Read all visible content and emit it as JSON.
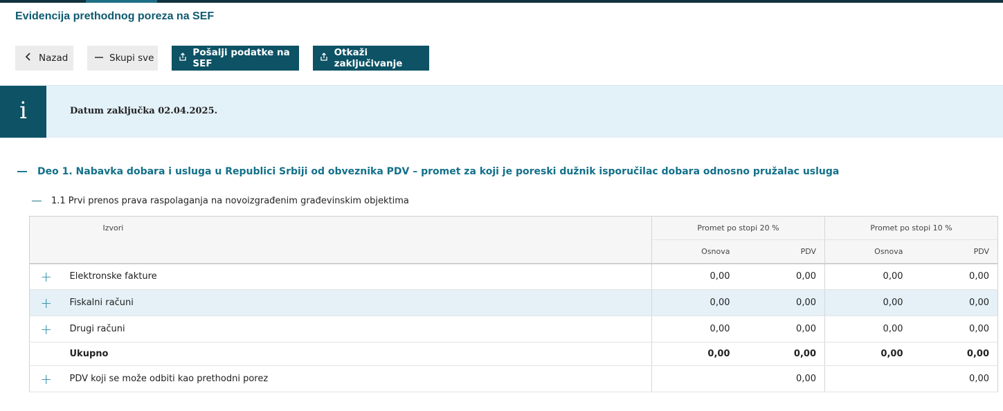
{
  "page": {
    "title": "Evidencija prethodnog poreza na SEF"
  },
  "toolbar": {
    "back_label": "Nazad",
    "collapse_label": "Skupi sve",
    "send_label": "Pošalji podatke na SEF",
    "cancel_label": "Otkaži zaključivanje"
  },
  "info": {
    "text": "Datum zaključka 02.04.2025."
  },
  "section1": {
    "title": "Deo 1. Nabavka dobara i usluga u Republici Srbiji od obveznika PDV – promet za koji je poreski dužnik isporučilac dobara odnosno pružalac usluga",
    "sub": {
      "title": "1.1 Prvi prenos prava raspolaganja na novoizgrađenim građevinskim objektima",
      "table": {
        "headers": {
          "izvori": "Izvori",
          "group20": "Promet po stopi 20 %",
          "group10": "Promet po stopi 10 %",
          "osnova": "Osnova",
          "pdv": "PDV"
        },
        "rows": [
          {
            "label": "Elektronske fakture",
            "o20": "0,00",
            "p20": "0,00",
            "o10": "0,00",
            "p10": "0,00"
          },
          {
            "label": "Fiskalni računi",
            "o20": "0,00",
            "p20": "0,00",
            "o10": "0,00",
            "p10": "0,00"
          },
          {
            "label": "Drugi računi",
            "o20": "0,00",
            "p20": "0,00",
            "o10": "0,00",
            "p10": "0,00"
          }
        ],
        "total": {
          "label": "Ukupno",
          "o20": "0,00",
          "p20": "0,00",
          "o10": "0,00",
          "p10": "0,00"
        },
        "deductible": {
          "label": "PDV koji se može odbiti kao prethodni porez",
          "p20": "0,00",
          "p10": "0,00"
        }
      }
    }
  },
  "colors": {
    "primary": "#0d5265",
    "accent": "#137089",
    "info_bg": "#e3f1f9",
    "highlight_row": "#e5f1f7"
  },
  "icons": {
    "back": "chevron-left-icon",
    "collapse": "minus-icon",
    "send": "share-upload-icon",
    "cancel": "share-upload-icon",
    "info": "info-icon",
    "expand": "plus-icon"
  }
}
